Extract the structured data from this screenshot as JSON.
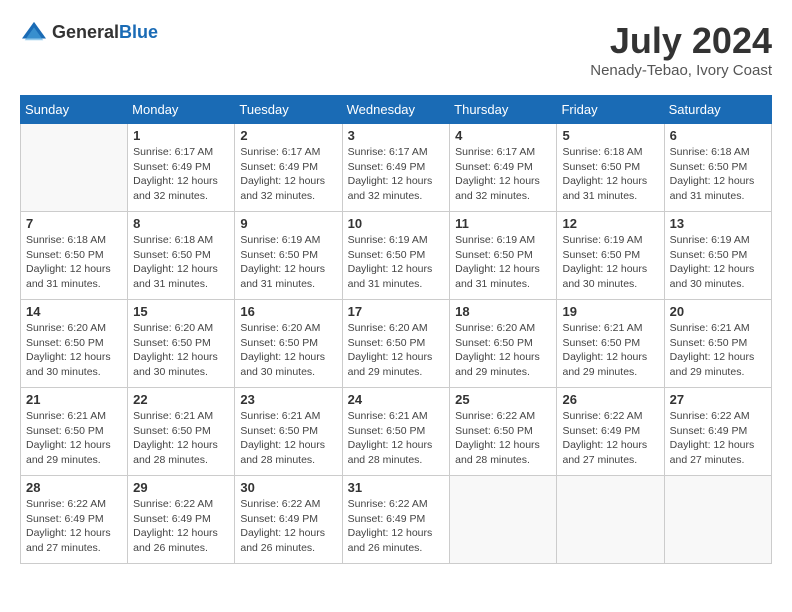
{
  "logo": {
    "general": "General",
    "blue": "Blue"
  },
  "title": {
    "month_year": "July 2024",
    "location": "Nenady-Tebao, Ivory Coast"
  },
  "headers": [
    "Sunday",
    "Monday",
    "Tuesday",
    "Wednesday",
    "Thursday",
    "Friday",
    "Saturday"
  ],
  "weeks": [
    [
      {
        "day": "",
        "info": ""
      },
      {
        "day": "1",
        "info": "Sunrise: 6:17 AM\nSunset: 6:49 PM\nDaylight: 12 hours\nand 32 minutes."
      },
      {
        "day": "2",
        "info": "Sunrise: 6:17 AM\nSunset: 6:49 PM\nDaylight: 12 hours\nand 32 minutes."
      },
      {
        "day": "3",
        "info": "Sunrise: 6:17 AM\nSunset: 6:49 PM\nDaylight: 12 hours\nand 32 minutes."
      },
      {
        "day": "4",
        "info": "Sunrise: 6:17 AM\nSunset: 6:49 PM\nDaylight: 12 hours\nand 32 minutes."
      },
      {
        "day": "5",
        "info": "Sunrise: 6:18 AM\nSunset: 6:50 PM\nDaylight: 12 hours\nand 31 minutes."
      },
      {
        "day": "6",
        "info": "Sunrise: 6:18 AM\nSunset: 6:50 PM\nDaylight: 12 hours\nand 31 minutes."
      }
    ],
    [
      {
        "day": "7",
        "info": "Sunrise: 6:18 AM\nSunset: 6:50 PM\nDaylight: 12 hours\nand 31 minutes."
      },
      {
        "day": "8",
        "info": "Sunrise: 6:18 AM\nSunset: 6:50 PM\nDaylight: 12 hours\nand 31 minutes."
      },
      {
        "day": "9",
        "info": "Sunrise: 6:19 AM\nSunset: 6:50 PM\nDaylight: 12 hours\nand 31 minutes."
      },
      {
        "day": "10",
        "info": "Sunrise: 6:19 AM\nSunset: 6:50 PM\nDaylight: 12 hours\nand 31 minutes."
      },
      {
        "day": "11",
        "info": "Sunrise: 6:19 AM\nSunset: 6:50 PM\nDaylight: 12 hours\nand 31 minutes."
      },
      {
        "day": "12",
        "info": "Sunrise: 6:19 AM\nSunset: 6:50 PM\nDaylight: 12 hours\nand 30 minutes."
      },
      {
        "day": "13",
        "info": "Sunrise: 6:19 AM\nSunset: 6:50 PM\nDaylight: 12 hours\nand 30 minutes."
      }
    ],
    [
      {
        "day": "14",
        "info": "Sunrise: 6:20 AM\nSunset: 6:50 PM\nDaylight: 12 hours\nand 30 minutes."
      },
      {
        "day": "15",
        "info": "Sunrise: 6:20 AM\nSunset: 6:50 PM\nDaylight: 12 hours\nand 30 minutes."
      },
      {
        "day": "16",
        "info": "Sunrise: 6:20 AM\nSunset: 6:50 PM\nDaylight: 12 hours\nand 30 minutes."
      },
      {
        "day": "17",
        "info": "Sunrise: 6:20 AM\nSunset: 6:50 PM\nDaylight: 12 hours\nand 29 minutes."
      },
      {
        "day": "18",
        "info": "Sunrise: 6:20 AM\nSunset: 6:50 PM\nDaylight: 12 hours\nand 29 minutes."
      },
      {
        "day": "19",
        "info": "Sunrise: 6:21 AM\nSunset: 6:50 PM\nDaylight: 12 hours\nand 29 minutes."
      },
      {
        "day": "20",
        "info": "Sunrise: 6:21 AM\nSunset: 6:50 PM\nDaylight: 12 hours\nand 29 minutes."
      }
    ],
    [
      {
        "day": "21",
        "info": "Sunrise: 6:21 AM\nSunset: 6:50 PM\nDaylight: 12 hours\nand 29 minutes."
      },
      {
        "day": "22",
        "info": "Sunrise: 6:21 AM\nSunset: 6:50 PM\nDaylight: 12 hours\nand 28 minutes."
      },
      {
        "day": "23",
        "info": "Sunrise: 6:21 AM\nSunset: 6:50 PM\nDaylight: 12 hours\nand 28 minutes."
      },
      {
        "day": "24",
        "info": "Sunrise: 6:21 AM\nSunset: 6:50 PM\nDaylight: 12 hours\nand 28 minutes."
      },
      {
        "day": "25",
        "info": "Sunrise: 6:22 AM\nSunset: 6:50 PM\nDaylight: 12 hours\nand 28 minutes."
      },
      {
        "day": "26",
        "info": "Sunrise: 6:22 AM\nSunset: 6:49 PM\nDaylight: 12 hours\nand 27 minutes."
      },
      {
        "day": "27",
        "info": "Sunrise: 6:22 AM\nSunset: 6:49 PM\nDaylight: 12 hours\nand 27 minutes."
      }
    ],
    [
      {
        "day": "28",
        "info": "Sunrise: 6:22 AM\nSunset: 6:49 PM\nDaylight: 12 hours\nand 27 minutes."
      },
      {
        "day": "29",
        "info": "Sunrise: 6:22 AM\nSunset: 6:49 PM\nDaylight: 12 hours\nand 26 minutes."
      },
      {
        "day": "30",
        "info": "Sunrise: 6:22 AM\nSunset: 6:49 PM\nDaylight: 12 hours\nand 26 minutes."
      },
      {
        "day": "31",
        "info": "Sunrise: 6:22 AM\nSunset: 6:49 PM\nDaylight: 12 hours\nand 26 minutes."
      },
      {
        "day": "",
        "info": ""
      },
      {
        "day": "",
        "info": ""
      },
      {
        "day": "",
        "info": ""
      }
    ]
  ]
}
